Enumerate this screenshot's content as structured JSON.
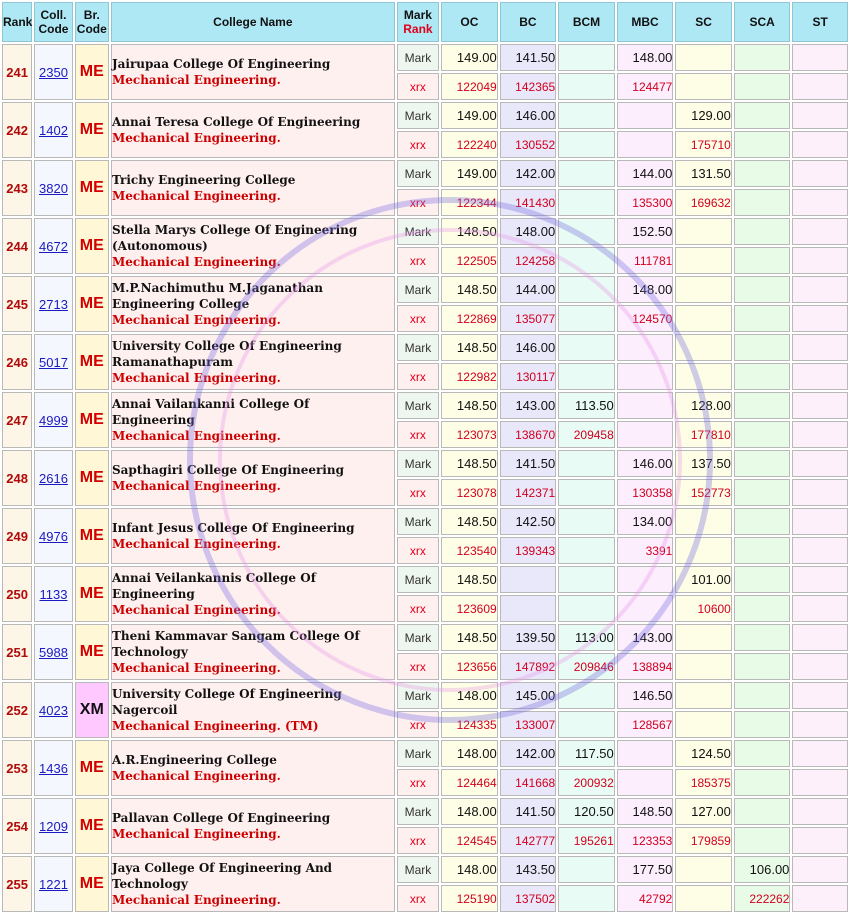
{
  "header": {
    "rank": "Rank",
    "coll_code": "Coll. Code",
    "br_code": "Br. Code",
    "college_name": "College Name",
    "mark": "Mark",
    "rank_sub": "Rank",
    "oc": "OC",
    "bc": "BC",
    "bcm": "BCM",
    "mbc": "MBC",
    "sc": "SC",
    "sca": "SCA",
    "st": "ST"
  },
  "row_labels": {
    "mark": "Mark",
    "rank": "xrx"
  },
  "colors": {
    "header_bg": "#aee8f5",
    "accent_red": "#cc0000",
    "link_blue": "#1a1ac2"
  },
  "rows": [
    {
      "rank": "241",
      "code": "2350",
      "br": "ME",
      "college": "Jairupaa College Of Engineering",
      "branch": "Mechanical Engineering.",
      "marks": [
        "149.00",
        "141.50",
        "",
        "148.00",
        "",
        "",
        ""
      ],
      "ranks": [
        "122049",
        "142365",
        "",
        "124477",
        "",
        "",
        ""
      ]
    },
    {
      "rank": "242",
      "code": "1402",
      "br": "ME",
      "college": "Annai Teresa College Of Engineering",
      "branch": "Mechanical Engineering.",
      "marks": [
        "149.00",
        "146.00",
        "",
        "",
        "129.00",
        "",
        ""
      ],
      "ranks": [
        "122240",
        "130552",
        "",
        "",
        "175710",
        "",
        ""
      ]
    },
    {
      "rank": "243",
      "code": "3820",
      "br": "ME",
      "college": "Trichy Engineering College",
      "branch": "Mechanical Engineering.",
      "marks": [
        "149.00",
        "142.00",
        "",
        "144.00",
        "131.50",
        "",
        ""
      ],
      "ranks": [
        "122344",
        "141430",
        "",
        "135300",
        "169632",
        "",
        ""
      ]
    },
    {
      "rank": "244",
      "code": "4672",
      "br": "ME",
      "college": "Stella Marys College Of Engineering (Autonomous)",
      "branch": "Mechanical Engineering.",
      "marks": [
        "148.50",
        "148.00",
        "",
        "152.50",
        "",
        "",
        ""
      ],
      "ranks": [
        "122505",
        "124258",
        "",
        "111781",
        "",
        "",
        ""
      ]
    },
    {
      "rank": "245",
      "code": "2713",
      "br": "ME",
      "college": "M.P.Nachimuthu M.Jaganathan Engineering College",
      "branch": "Mechanical Engineering.",
      "marks": [
        "148.50",
        "144.00",
        "",
        "148.00",
        "",
        "",
        ""
      ],
      "ranks": [
        "122869",
        "135077",
        "",
        "124570",
        "",
        "",
        ""
      ]
    },
    {
      "rank": "246",
      "code": "5017",
      "br": "ME",
      "college": "University College Of Engineering Ramanathapuram",
      "branch": "Mechanical Engineering.",
      "marks": [
        "148.50",
        "146.00",
        "",
        "",
        "",
        "",
        ""
      ],
      "ranks": [
        "122982",
        "130117",
        "",
        "",
        "",
        "",
        ""
      ]
    },
    {
      "rank": "247",
      "code": "4999",
      "br": "ME",
      "college": "Annai Vailankanni College Of Engineering",
      "branch": "Mechanical Engineering.",
      "marks": [
        "148.50",
        "143.00",
        "113.50",
        "",
        "128.00",
        "",
        ""
      ],
      "ranks": [
        "123073",
        "138670",
        "209458",
        "",
        "177810",
        "",
        ""
      ]
    },
    {
      "rank": "248",
      "code": "2616",
      "br": "ME",
      "college": "Sapthagiri College Of Engineering",
      "branch": "Mechanical Engineering.",
      "marks": [
        "148.50",
        "141.50",
        "",
        "146.00",
        "137.50",
        "",
        ""
      ],
      "ranks": [
        "123078",
        "142371",
        "",
        "130358",
        "152773",
        "",
        ""
      ]
    },
    {
      "rank": "249",
      "code": "4976",
      "br": "ME",
      "college": "Infant Jesus College Of Engineering",
      "branch": "Mechanical Engineering.",
      "marks": [
        "148.50",
        "142.50",
        "",
        "134.00",
        "",
        "",
        ""
      ],
      "ranks": [
        "123540",
        "139343",
        "",
        "3391",
        "",
        "",
        ""
      ]
    },
    {
      "rank": "250",
      "code": "1133",
      "br": "ME",
      "college": "Annai Veilankannis College Of Engineering",
      "branch": "Mechanical Engineering.",
      "marks": [
        "148.50",
        "",
        "",
        "",
        "101.00",
        "",
        ""
      ],
      "ranks": [
        "123609",
        "",
        "",
        "",
        "10600",
        "",
        ""
      ]
    },
    {
      "rank": "251",
      "code": "5988",
      "br": "ME",
      "college": "Theni Kammavar Sangam College Of Technology",
      "branch": "Mechanical Engineering.",
      "marks": [
        "148.50",
        "139.50",
        "113.00",
        "143.00",
        "",
        "",
        ""
      ],
      "ranks": [
        "123656",
        "147892",
        "209846",
        "138894",
        "",
        "",
        ""
      ]
    },
    {
      "rank": "252",
      "code": "4023",
      "br": "XM",
      "college": "University College Of Engineering Nagercoil",
      "branch": "Mechanical Engineering. (TM)",
      "marks": [
        "148.00",
        "145.00",
        "",
        "146.50",
        "",
        "",
        ""
      ],
      "ranks": [
        "124335",
        "133007",
        "",
        "128567",
        "",
        "",
        ""
      ]
    },
    {
      "rank": "253",
      "code": "1436",
      "br": "ME",
      "college": "A.R.Engineering College",
      "branch": "Mechanical Engineering.",
      "marks": [
        "148.00",
        "142.00",
        "117.50",
        "",
        "124.50",
        "",
        ""
      ],
      "ranks": [
        "124464",
        "141668",
        "200932",
        "",
        "185375",
        "",
        ""
      ]
    },
    {
      "rank": "254",
      "code": "1209",
      "br": "ME",
      "college": "Pallavan College Of Engineering",
      "branch": "Mechanical Engineering.",
      "marks": [
        "148.00",
        "141.50",
        "120.50",
        "148.50",
        "127.00",
        "",
        ""
      ],
      "ranks": [
        "124545",
        "142777",
        "195261",
        "123353",
        "179859",
        "",
        ""
      ]
    },
    {
      "rank": "255",
      "code": "1221",
      "br": "ME",
      "college": "Jaya College Of Engineering And Technology",
      "branch": "Mechanical Engineering.",
      "marks": [
        "148.00",
        "143.50",
        "",
        "177.50",
        "",
        "106.00",
        ""
      ],
      "ranks": [
        "125190",
        "137502",
        "",
        "42792",
        "",
        "222262",
        ""
      ]
    }
  ]
}
